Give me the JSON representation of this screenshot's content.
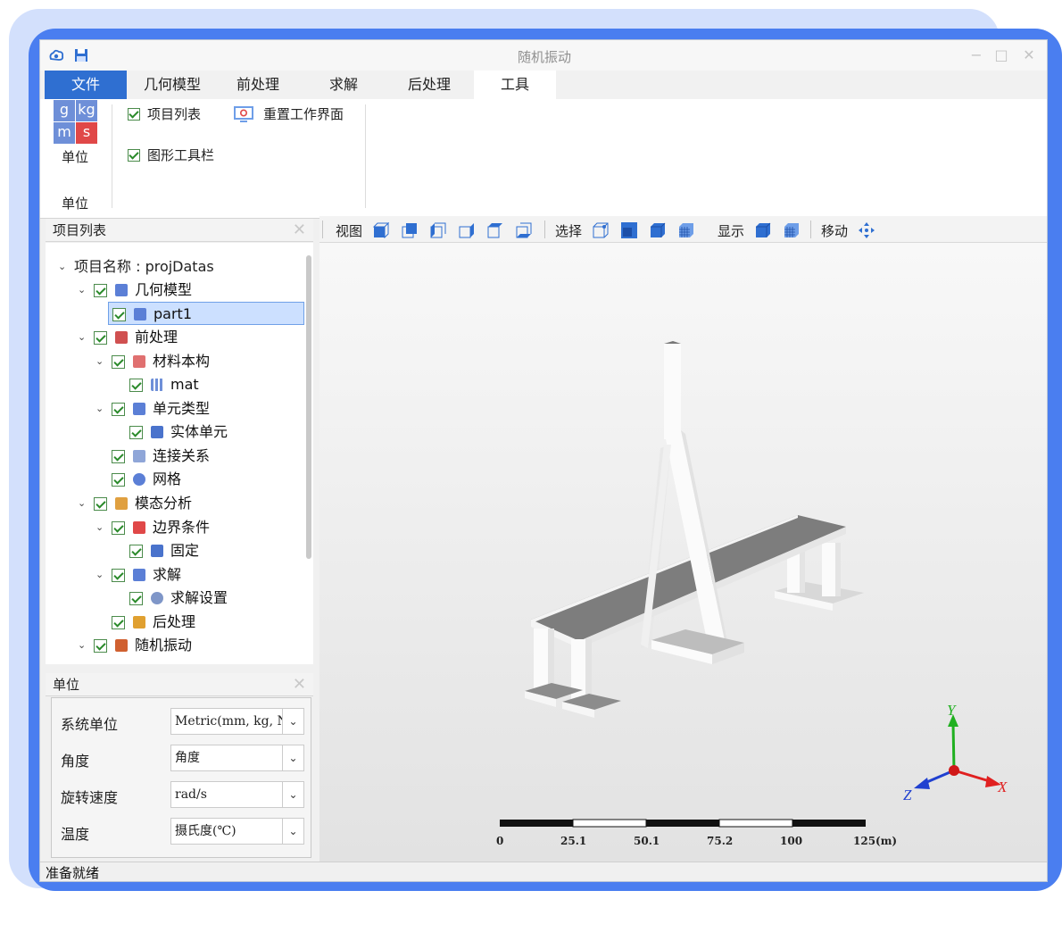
{
  "window": {
    "title": "随机振动"
  },
  "tabs": [
    {
      "label": "文件"
    },
    {
      "label": "几何模型"
    },
    {
      "label": "前处理"
    },
    {
      "label": "求解"
    },
    {
      "label": "后处理"
    },
    {
      "label": "工具"
    }
  ],
  "ribbon": {
    "unit_tiles": [
      "g",
      "kg",
      "m",
      "s"
    ],
    "unit_button_label": "单位",
    "group_label": "单位",
    "project_list_checkbox": "项目列表",
    "reset_workspace_label": "重置工作界面",
    "graphic_toolbar_checkbox": "图形工具栏"
  },
  "project_panel": {
    "title": "项目列表",
    "tree": [
      {
        "label": "项目名称 : projDatas"
      },
      {
        "label": "几何模型"
      },
      {
        "label": "part1"
      },
      {
        "label": "前处理"
      },
      {
        "label": "材料本构"
      },
      {
        "label": "mat"
      },
      {
        "label": "单元类型"
      },
      {
        "label": "实体单元"
      },
      {
        "label": "连接关系"
      },
      {
        "label": "网格"
      },
      {
        "label": "模态分析"
      },
      {
        "label": "边界条件"
      },
      {
        "label": "固定"
      },
      {
        "label": "求解"
      },
      {
        "label": "求解设置"
      },
      {
        "label": "后处理"
      },
      {
        "label": "随机振动"
      }
    ]
  },
  "unit_panel": {
    "title": "单位",
    "rows": [
      {
        "label": "系统单位",
        "value": "Metric(mm, kg, N, :"
      },
      {
        "label": "角度",
        "value": "角度"
      },
      {
        "label": "旋转速度",
        "value": "rad/s"
      },
      {
        "label": "温度",
        "value": "摄氏度(℃)"
      }
    ]
  },
  "view_toolbar": {
    "view_label": "视图",
    "select_label": "选择",
    "display_label": "显示",
    "move_label": "移动"
  },
  "viewport": {
    "scale_labels": [
      "0",
      "25.1",
      "50.1",
      "75.2",
      "100",
      "125(m)"
    ],
    "axes": {
      "x": "X",
      "y": "Y",
      "z": "Z"
    },
    "colors": {
      "x": "#e02020",
      "y": "#20b020",
      "z": "#2040d0"
    }
  },
  "status": {
    "text": "准备就绪"
  },
  "colors": {
    "accent": "#2f6fd1",
    "frame": "#4a7ef0"
  }
}
